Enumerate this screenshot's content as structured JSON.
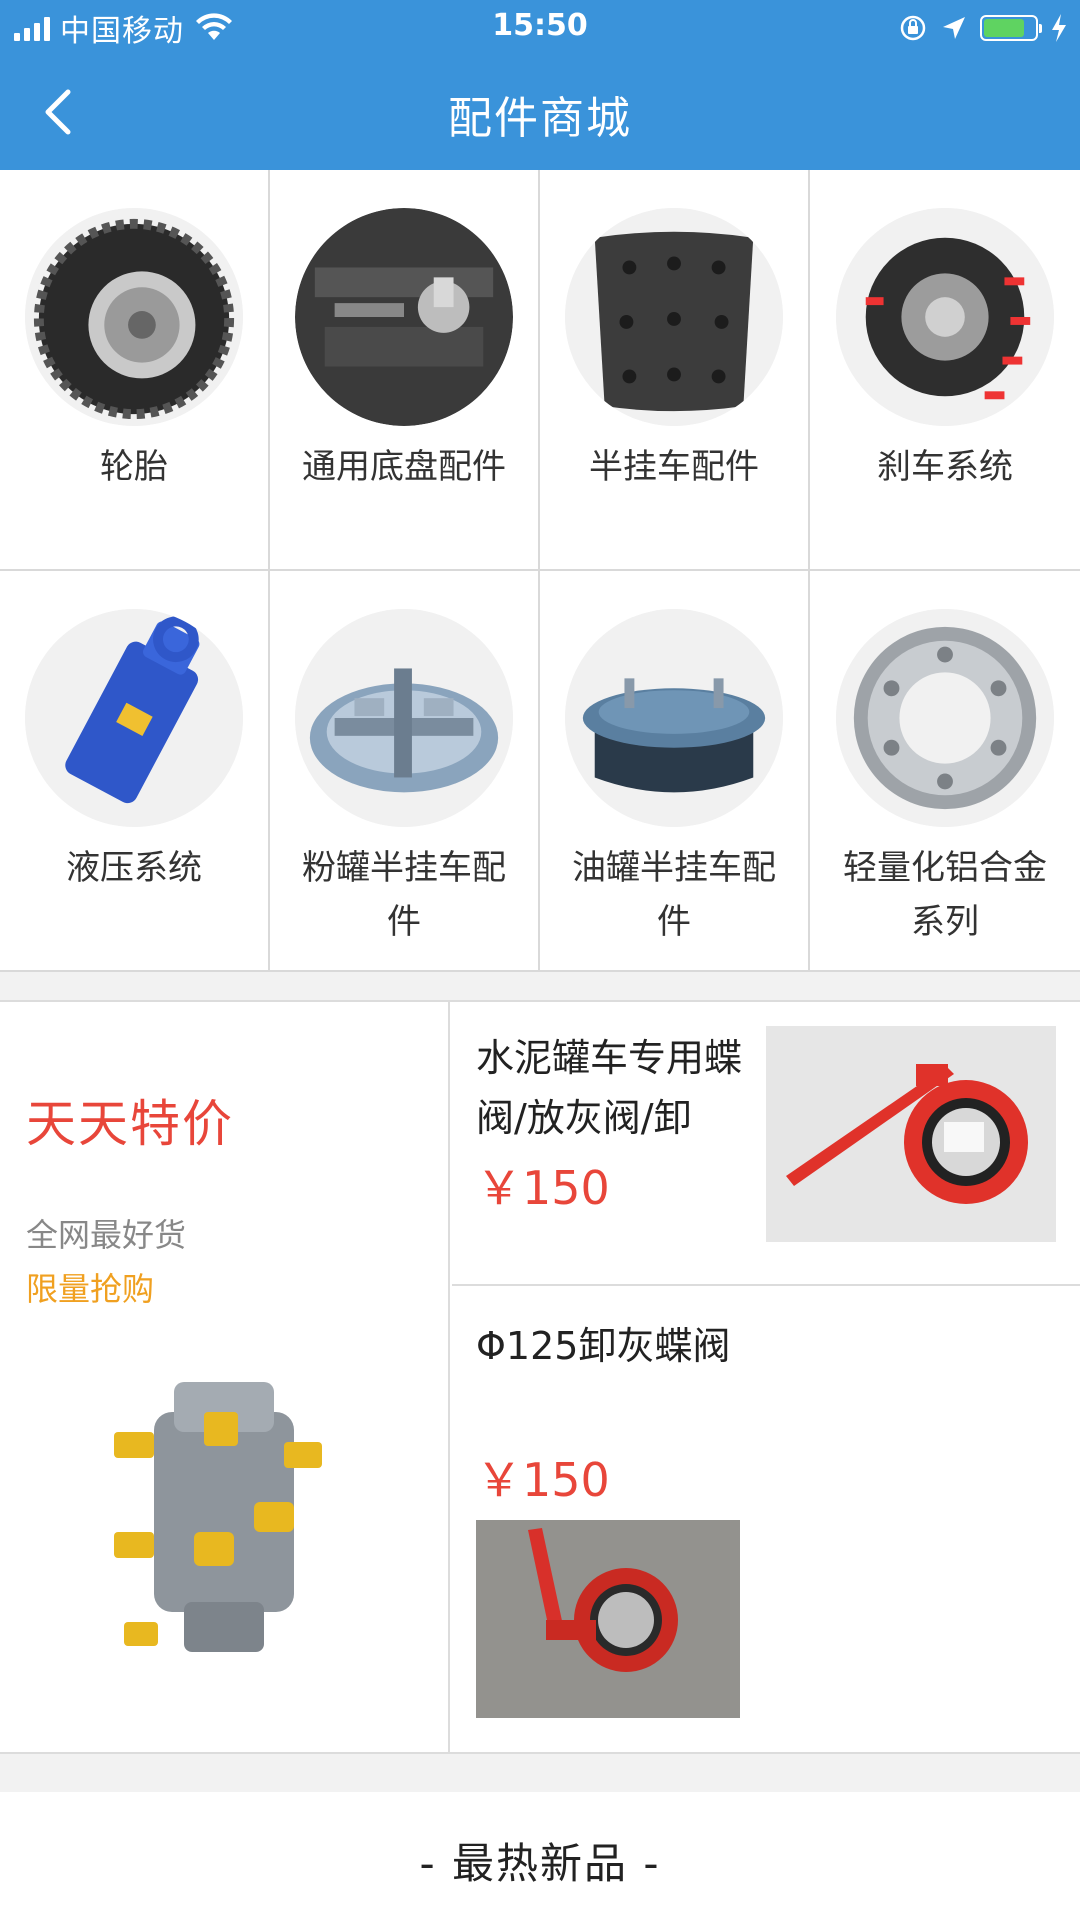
{
  "status_bar": {
    "carrier": "中国移动",
    "time": "15:50",
    "battery_level": 0.8
  },
  "nav": {
    "title": "配件商城",
    "back_icon": "chevron-left-icon"
  },
  "categories": [
    {
      "label": "轮胎",
      "icon": "tire-icon"
    },
    {
      "label": "通用底盘配件",
      "icon": "chassis-part-icon"
    },
    {
      "label": "半挂车配件",
      "icon": "brake-pad-icon"
    },
    {
      "label": "刹车系统",
      "icon": "brake-hub-icon"
    },
    {
      "label": "液压系统",
      "icon": "hydraulic-cylinder-icon"
    },
    {
      "label": "粉罐半挂车配件",
      "icon": "powder-tank-lid-icon"
    },
    {
      "label": "油罐半挂车配件",
      "icon": "oil-tank-manhole-icon"
    },
    {
      "label": "轻量化铝合金系列",
      "icon": "aluminum-wheel-icon"
    }
  ],
  "promo": {
    "title": "天天特价",
    "subtitle": "全网最好货",
    "note": "限量抢购",
    "colors": {
      "title": "#e8463a",
      "note": "#f0a020"
    }
  },
  "products": [
    {
      "name": "水泥罐车专用蝶阀/放灰阀/卸",
      "price": "￥150"
    },
    {
      "name": "Φ125卸灰蝶阀",
      "price": "￥150"
    }
  ],
  "hot": {
    "title": "- 最热新品 -"
  },
  "colors": {
    "brand": "#3a93da",
    "price": "#e8463a"
  }
}
